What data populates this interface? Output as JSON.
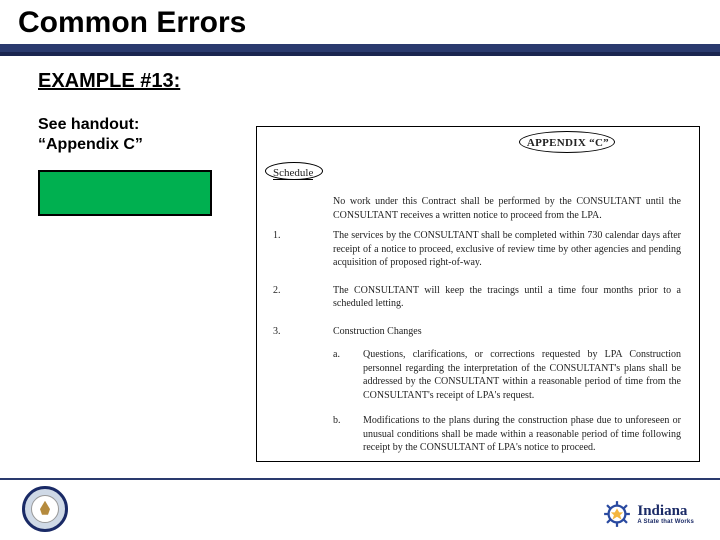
{
  "header": {
    "title": "Common Errors"
  },
  "left": {
    "example_label": "EXAMPLE #13:",
    "handout_line1": "See handout:",
    "handout_line2": "“Appendix C”"
  },
  "doc": {
    "appendix_label": "APPENDIX “C”",
    "schedule_label": "Schedule",
    "intro": "No work under this Contract shall be performed by the CONSULTANT until the CONSULTANT receives a written notice to proceed from the LPA.",
    "items": [
      {
        "num": "1.",
        "text": "The services by the CONSULTANT shall be completed within 730 calendar days after receipt of a notice to proceed, exclusive of review time by other agencies and pending acquisition of proposed right-of-way."
      },
      {
        "num": "2.",
        "text": "The CONSULTANT will keep the tracings until a time four months prior to a scheduled letting."
      },
      {
        "num": "3.",
        "text": "Construction Changes",
        "subs": [
          {
            "lbl": "a.",
            "text": "Questions, clarifications, or corrections requested by LPA Construction personnel regarding the interpretation of the CONSULTANT's plans shall be addressed by the CONSULTANT within a reasonable period of time from the CONSULTANT's receipt of LPA's request."
          },
          {
            "lbl": "b.",
            "text": "Modifications to the plans during the construction phase due to unforeseen or unusual conditions shall be made within a reasonable period of time following receipt by the CONSULTANT of LPA's notice to proceed."
          }
        ]
      }
    ]
  },
  "footer": {
    "state_name": "Indiana",
    "state_tag": "A State that Works"
  }
}
